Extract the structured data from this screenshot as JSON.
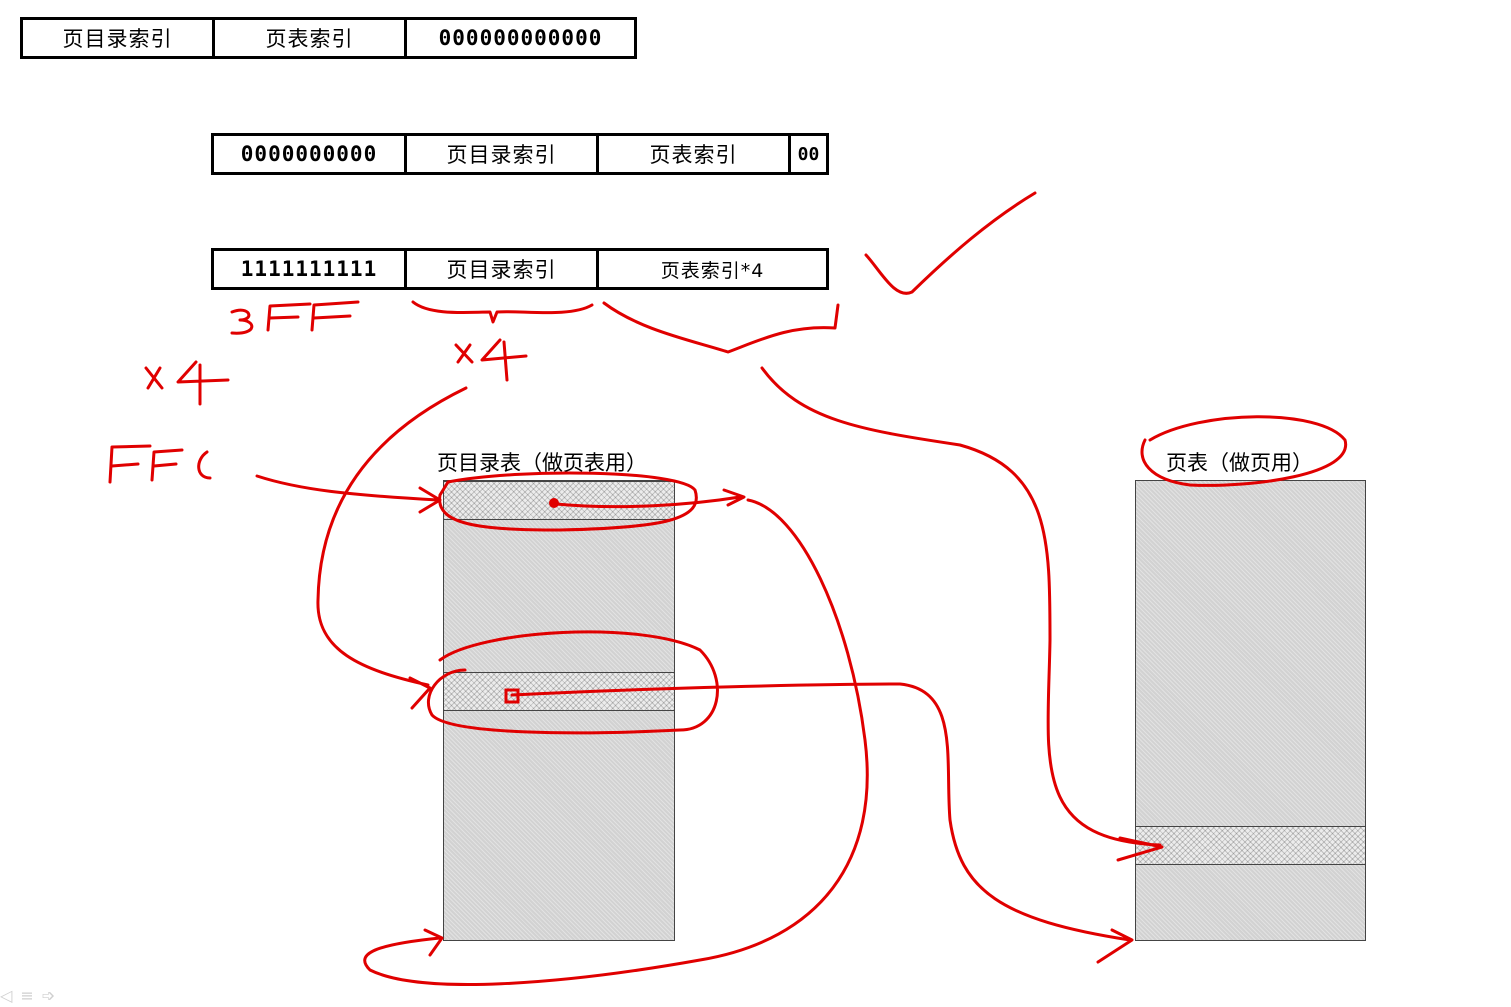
{
  "linear_address": {
    "fields": [
      "页目录索引",
      "页表索引",
      "000000000000"
    ]
  },
  "pde_offset": {
    "fields": [
      "0000000000",
      "页目录索引",
      "页表索引",
      "00"
    ]
  },
  "pte_offset": {
    "fields": [
      "1111111111",
      "页目录索引",
      "页表索引*4"
    ]
  },
  "page_directory": {
    "title": "页目录表（做页表用）"
  },
  "page_table": {
    "title": "页表（做页用）"
  },
  "annotations": {
    "label_3ff": "3FF",
    "label_x4_left": "×4",
    "label_x4_mid": "×4",
    "label_ffc": "FFC",
    "color": "#e00000"
  },
  "player_icons": [
    "prev-icon",
    "menu-icon",
    "next-icon"
  ]
}
